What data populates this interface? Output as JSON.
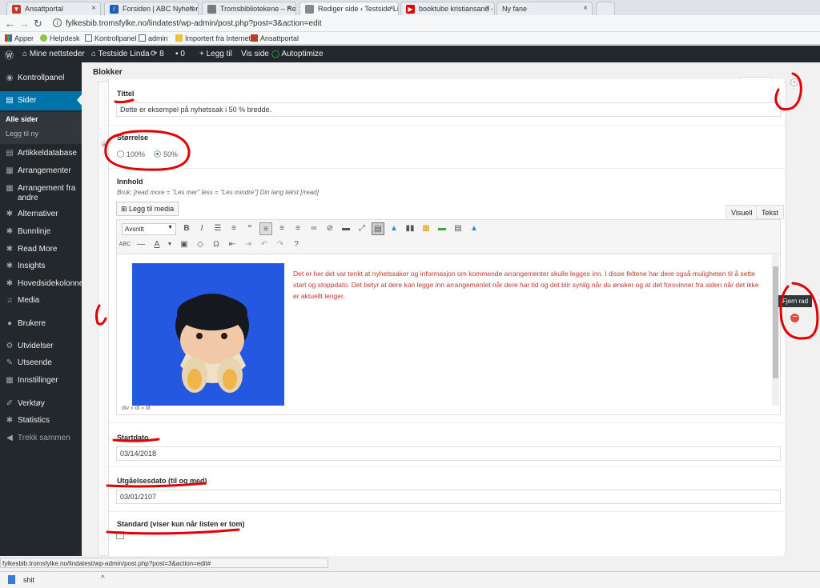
{
  "browser": {
    "tabs": [
      {
        "label": "Ansattportal",
        "fav_color": "#c0392b"
      },
      {
        "label": "Forsiden | ABC Nyheter",
        "fav_color": "#1a5fb4"
      },
      {
        "label": "Tromsbibliotekene – Res",
        "fav_color": "#7a7a7a"
      },
      {
        "label": "Rediger side ‹ Testside Li",
        "fav_color": "#555555"
      },
      {
        "label": "booktube kristiansand -",
        "fav_color": "#e00000"
      },
      {
        "label": "Ny fane",
        "fav_color": "#dddddd"
      }
    ],
    "url": "fylkesbib.tromsfylke.no/lindatest/wp-admin/post.php?post=3&action=edit",
    "bookmarks": [
      "Apper",
      "Helpdesk",
      "Kontrollpanel",
      "admin",
      "Importert fra Internet",
      "Ansattportal"
    ]
  },
  "adminbar": {
    "sites": "Mine nettsteder",
    "site_name": "Testside Linda",
    "updates": "8",
    "comments": "0",
    "new": "Legg til",
    "view": "Vis side",
    "autoptimize": "Autoptimize"
  },
  "sidebar": {
    "items": [
      {
        "label": "Kontrollpanel",
        "icon": "dashboard-icon"
      },
      {
        "label": "Sider",
        "icon": "pages-icon"
      },
      {
        "label": "Artikkeldatabase",
        "icon": "database-icon"
      },
      {
        "label": "Arrangementer",
        "icon": "calendar-icon"
      },
      {
        "label": "Arrangement fra",
        "label2": "andre",
        "icon": "calendar-icon"
      },
      {
        "label": "Alternativer",
        "icon": "gear-icon"
      },
      {
        "label": "Bunnlinje",
        "icon": "gear-icon"
      },
      {
        "label": "Read More",
        "icon": "gear-icon"
      },
      {
        "label": "Insights",
        "icon": "gear-icon"
      },
      {
        "label": "Hovedsidekolonne",
        "icon": "gear-icon"
      },
      {
        "label": "Media",
        "icon": "media-icon"
      },
      {
        "label": "Brukere",
        "icon": "users-icon"
      },
      {
        "label": "Utvidelser",
        "icon": "plugins-icon"
      },
      {
        "label": "Utseende",
        "icon": "appearance-icon"
      },
      {
        "label": "Innstillinger",
        "icon": "settings-icon"
      },
      {
        "label": "Verktøy",
        "icon": "tools-icon"
      },
      {
        "label": "Statistics",
        "icon": "gear-icon"
      },
      {
        "label": "Trekk sammen",
        "icon": "collapse-icon"
      }
    ],
    "submenu": {
      "current": "Alle sider",
      "add": "Legg til ny"
    }
  },
  "content": {
    "section_label": "Blokker",
    "collapse_label": "Collapse",
    "row_number": "1",
    "fields": {
      "title_label": "Tittel",
      "title_value": "Dette er eksempel på nyhetssak i 50 % bredde.",
      "size_label": "Størrelse",
      "size_options": [
        "100%",
        "50%"
      ],
      "size_selected": "50%",
      "content_label": "Innhold",
      "content_instructions": "Bruk: [read more = \"Les mer\" less = \"Les mindre\"] Din lang tekst [/read]",
      "media_button": "Legg til media",
      "tab_visual": "Visuell",
      "tab_text": "Tekst",
      "format_select": "Avsnitt",
      "editor_text": "Det er her det var tenkt at nyhetssaker og informasjon om kommende arrangementer skulle legges inn. I disse feltene har dere også muligheten til å sette start og stoppdato. Det betyr at dere kan legge inn arrangementet når dere har tid og det blir synlig når du ønsker og at det forsvinner fra siden når det ikke er aktuellt lenger.",
      "editor_path": "div » dl » dt",
      "start_label": "Startdato",
      "start_value": "03/14/2018",
      "expiry_label": "Utgåelsesdato (til og med)",
      "expiry_value": "03/01/2107",
      "default_label": "Standard (viser kun når listen er tom)"
    },
    "remove_row_tooltip": "Fjern rad"
  },
  "status": {
    "hover_url": "fylkesbib.tromsfylke.no/lindatest/wp-admin/post.php?post=3&action=edit#",
    "download": "shit"
  },
  "annotation_color": "#e00000"
}
